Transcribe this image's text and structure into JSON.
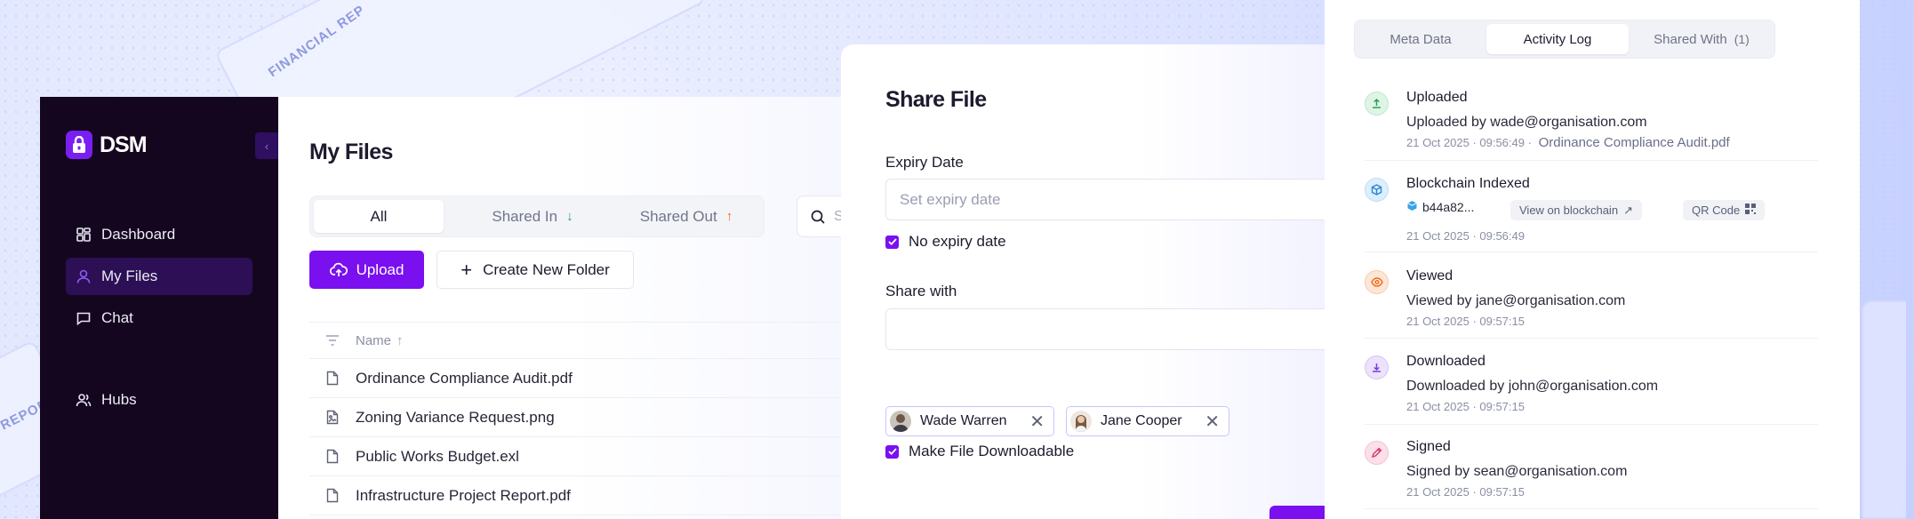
{
  "background": {
    "deco_text_1": "FINANCIAL REP",
    "deco_text_2": "REPORT"
  },
  "sidebar": {
    "brand": "DSM",
    "items": [
      {
        "label": "Dashboard",
        "icon": "dashboard-icon"
      },
      {
        "label": "My Files",
        "icon": "user-icon",
        "active": true
      },
      {
        "label": "Chat",
        "icon": "chat-icon"
      },
      {
        "label": "Hubs",
        "icon": "users-icon"
      }
    ]
  },
  "main": {
    "title": "My Files",
    "tabs": [
      {
        "label": "All",
        "active": true
      },
      {
        "label": "Shared In",
        "arrow_color": "#22a35a"
      },
      {
        "label": "Shared Out",
        "arrow_color": "#ef6b1a"
      }
    ],
    "search_placeholder": "S",
    "upload_label": "Upload",
    "create_folder_label": "Create New Folder",
    "table": {
      "name_header": "Name",
      "rows": [
        {
          "name": "Ordinance Compliance Audit.pdf",
          "icon": "document-icon"
        },
        {
          "name": "Zoning Variance Request.png",
          "icon": "image-file-icon"
        },
        {
          "name": "Public Works Budget.exl",
          "icon": "document-icon"
        },
        {
          "name": "Infrastructure Project Report.pdf",
          "icon": "document-icon"
        }
      ]
    }
  },
  "share_modal": {
    "title": "Share File",
    "expiry_label": "Expiry Date",
    "expiry_placeholder": "Set expiry date",
    "no_expiry_label": "No expiry date",
    "no_expiry_checked": true,
    "share_with_label": "Share with",
    "recipients": [
      {
        "name": "Wade Warren"
      },
      {
        "name": "Jane Cooper"
      }
    ],
    "downloadable_label": "Make File Downloadable",
    "downloadable_checked": true
  },
  "panel": {
    "tabs": [
      {
        "label": "Meta Data"
      },
      {
        "label": "Activity Log",
        "active": true
      },
      {
        "label": "Shared With",
        "count": "(1)"
      }
    ],
    "activities": [
      {
        "title": "Uploaded",
        "desc": "Uploaded by wade@organisation.com",
        "time": "21 Oct 2025 · 09:56:49 ·",
        "file": "Ordinance Compliance Audit.pdf",
        "icon": "upload-icon",
        "color": "#2f9e58",
        "bg": "#def5e6"
      },
      {
        "title": "Blockchain Indexed",
        "hash": "b44a82...",
        "chain_link": "View on blockchain",
        "qr_label": "QR Code",
        "time": "21 Oct 2025 · 09:56:49",
        "icon": "cube-icon",
        "color": "#2687d6",
        "bg": "#ddeefc"
      },
      {
        "title": "Viewed",
        "desc": "Viewed by jane@organisation.com",
        "time": "21 Oct 2025 · 09:57:15",
        "icon": "eye-icon",
        "color": "#ef6b1a",
        "bg": "#fde6d8"
      },
      {
        "title": "Downloaded",
        "desc": "Downloaded by john@organisation.com",
        "time": "21 Oct 2025 · 09:57:15",
        "icon": "download-icon",
        "color": "#7a3de0",
        "bg": "#ece2fb"
      },
      {
        "title": "Signed",
        "desc": "Signed by sean@organisation.com",
        "time": "21 Oct 2025 · 09:57:15",
        "icon": "pen-icon",
        "color": "#d9366f",
        "bg": "#fbe0ea"
      }
    ]
  }
}
